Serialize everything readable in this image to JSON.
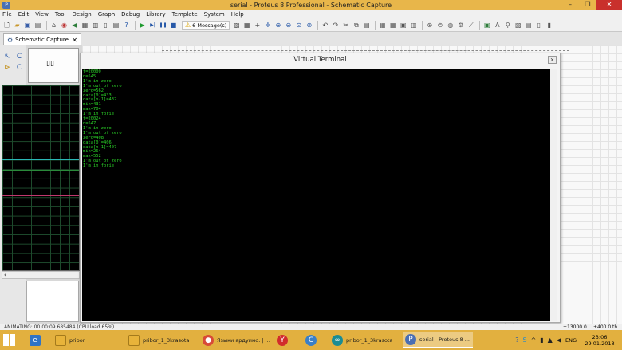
{
  "window": {
    "app_icon": "proteus-icon",
    "title": "serial - Proteus 8 Professional - Schematic Capture",
    "minimize": "–",
    "maximize": "❐",
    "close": "✕"
  },
  "menu": [
    "File",
    "Edit",
    "View",
    "Tool",
    "Design",
    "Graph",
    "Debug",
    "Library",
    "Template",
    "System",
    "Help"
  ],
  "toolbar": {
    "messages_label": "6 Message(s)",
    "icons_left": [
      "new-icon",
      "open-icon",
      "save-icon",
      "import-icon",
      "home-icon",
      "component-icon",
      "pcb-icon",
      "gerber-icon",
      "3d-icon",
      "bom-icon",
      "report-icon",
      "help-icon"
    ],
    "play_glyphs": {
      "run": "▶",
      "step": "▶|",
      "pause": "❚❚",
      "stop": "■"
    },
    "icons_right": [
      "refresh-icon",
      "grid-icon",
      "origin-icon",
      "pan-icon",
      "zoom-in-icon",
      "zoom-out-icon",
      "zoom-all-icon",
      "zoom-area-icon",
      "undo-icon",
      "redo-icon",
      "cut-icon",
      "copy-icon",
      "paste-icon",
      "block-copy-icon",
      "block-move-icon",
      "block-rotate-icon",
      "block-delete-icon",
      "pick-device-icon",
      "make-device-icon",
      "package-icon",
      "decompose-icon",
      "wire-autorouter-icon",
      "search-icon",
      "property-icon",
      "netlist-icon",
      "design-rules-icon",
      "new-sheet-icon"
    ]
  },
  "tab": {
    "label": "Schematic Capture",
    "close": "✕"
  },
  "left_tools": [
    "↖",
    "C",
    "⊳",
    "C"
  ],
  "overview": {
    "chip_glyph": "▯▯"
  },
  "scope": {
    "traces": [
      {
        "color": "#d8d22c",
        "level": 0.165
      },
      {
        "color": "#2bb8b6",
        "level": 0.403
      },
      {
        "color": "#2a8a3a",
        "level": 0.456
      },
      {
        "color": "#c0386d",
        "level": 0.593
      }
    ]
  },
  "vterm": {
    "title": "Virtual Terminal",
    "close": "x",
    "lines": [
      "t=20000",
      "n=545",
      "I'm in zero",
      "I'm out of zero",
      "zero=562",
      "data[0]=433",
      "data[n-1]=432",
      "min=431",
      "max=704",
      "I'm in forie",
      "t=20024",
      "n=547",
      "I'm in zero",
      "I'm out of zero",
      "zero=408",
      "data[0]=406",
      "data[n-1]=407",
      "min=264",
      "max=552",
      "I'm out of zero",
      "I'm in forie"
    ]
  },
  "status": {
    "animating": "ANIMATING: 00:00:09.685484 (CPU load 65%)",
    "x_coord": "+13000.0",
    "y_coord": "+400.0",
    "unit": "th"
  },
  "taskbar": {
    "tasks": [
      {
        "label": "pribor",
        "icon": "folder-icon",
        "color": "#e8b33a"
      },
      {
        "label": "pribor_1_3krasota",
        "icon": "folder-icon",
        "color": "#e8b33a"
      },
      {
        "label": "Языки ардуино. | ...",
        "icon": "chrome-icon",
        "color": "#d84a38"
      },
      {
        "label": "",
        "icon": "yandex-icon",
        "color": "#d12c2c"
      },
      {
        "label": "",
        "icon": "c-icon",
        "color": "#3a7fc7"
      },
      {
        "label": "pribor_1_3krasota",
        "icon": "arduino-icon",
        "color": "#1b8c94"
      },
      {
        "label": "serial - Proteus 8 ...",
        "icon": "proteus-icon",
        "color": "#4a6fb3"
      }
    ],
    "language": "ENG",
    "time": "23:06",
    "date": "29.01.2018"
  }
}
